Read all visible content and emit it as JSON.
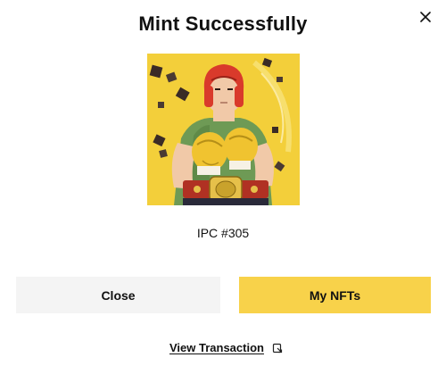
{
  "modal": {
    "title": "Mint Successfully",
    "close_icon": "close-icon"
  },
  "nft": {
    "name": "IPC #305",
    "image_description_icon": "boxer-nft-image"
  },
  "buttons": {
    "close_label": "Close",
    "my_nfts_label": "My NFTs"
  },
  "link": {
    "view_transaction_label": "View Transaction",
    "icon": "external-link-icon"
  },
  "colors": {
    "primary_button": "#f8d24a",
    "secondary_button": "#f4f4f4",
    "art_background": "#f3cf3a"
  }
}
